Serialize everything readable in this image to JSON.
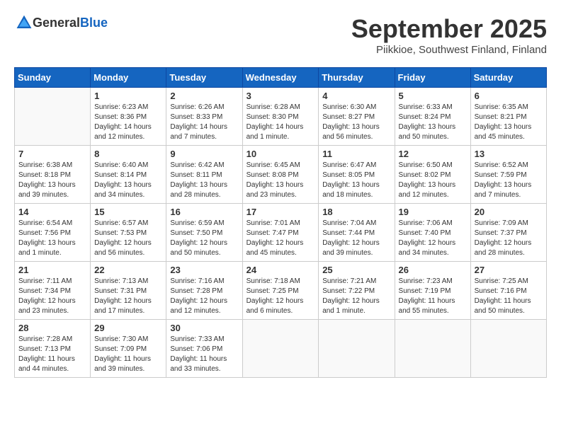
{
  "logo": {
    "general": "General",
    "blue": "Blue"
  },
  "header": {
    "month": "September 2025",
    "location": "Piikkioe, Southwest Finland, Finland"
  },
  "weekdays": [
    "Sunday",
    "Monday",
    "Tuesday",
    "Wednesday",
    "Thursday",
    "Friday",
    "Saturday"
  ],
  "weeks": [
    [
      {
        "day": "",
        "info": ""
      },
      {
        "day": "1",
        "info": "Sunrise: 6:23 AM\nSunset: 8:36 PM\nDaylight: 14 hours\nand 12 minutes."
      },
      {
        "day": "2",
        "info": "Sunrise: 6:26 AM\nSunset: 8:33 PM\nDaylight: 14 hours\nand 7 minutes."
      },
      {
        "day": "3",
        "info": "Sunrise: 6:28 AM\nSunset: 8:30 PM\nDaylight: 14 hours\nand 1 minute."
      },
      {
        "day": "4",
        "info": "Sunrise: 6:30 AM\nSunset: 8:27 PM\nDaylight: 13 hours\nand 56 minutes."
      },
      {
        "day": "5",
        "info": "Sunrise: 6:33 AM\nSunset: 8:24 PM\nDaylight: 13 hours\nand 50 minutes."
      },
      {
        "day": "6",
        "info": "Sunrise: 6:35 AM\nSunset: 8:21 PM\nDaylight: 13 hours\nand 45 minutes."
      }
    ],
    [
      {
        "day": "7",
        "info": "Sunrise: 6:38 AM\nSunset: 8:18 PM\nDaylight: 13 hours\nand 39 minutes."
      },
      {
        "day": "8",
        "info": "Sunrise: 6:40 AM\nSunset: 8:14 PM\nDaylight: 13 hours\nand 34 minutes."
      },
      {
        "day": "9",
        "info": "Sunrise: 6:42 AM\nSunset: 8:11 PM\nDaylight: 13 hours\nand 28 minutes."
      },
      {
        "day": "10",
        "info": "Sunrise: 6:45 AM\nSunset: 8:08 PM\nDaylight: 13 hours\nand 23 minutes."
      },
      {
        "day": "11",
        "info": "Sunrise: 6:47 AM\nSunset: 8:05 PM\nDaylight: 13 hours\nand 18 minutes."
      },
      {
        "day": "12",
        "info": "Sunrise: 6:50 AM\nSunset: 8:02 PM\nDaylight: 13 hours\nand 12 minutes."
      },
      {
        "day": "13",
        "info": "Sunrise: 6:52 AM\nSunset: 7:59 PM\nDaylight: 13 hours\nand 7 minutes."
      }
    ],
    [
      {
        "day": "14",
        "info": "Sunrise: 6:54 AM\nSunset: 7:56 PM\nDaylight: 13 hours\nand 1 minute."
      },
      {
        "day": "15",
        "info": "Sunrise: 6:57 AM\nSunset: 7:53 PM\nDaylight: 12 hours\nand 56 minutes."
      },
      {
        "day": "16",
        "info": "Sunrise: 6:59 AM\nSunset: 7:50 PM\nDaylight: 12 hours\nand 50 minutes."
      },
      {
        "day": "17",
        "info": "Sunrise: 7:01 AM\nSunset: 7:47 PM\nDaylight: 12 hours\nand 45 minutes."
      },
      {
        "day": "18",
        "info": "Sunrise: 7:04 AM\nSunset: 7:44 PM\nDaylight: 12 hours\nand 39 minutes."
      },
      {
        "day": "19",
        "info": "Sunrise: 7:06 AM\nSunset: 7:40 PM\nDaylight: 12 hours\nand 34 minutes."
      },
      {
        "day": "20",
        "info": "Sunrise: 7:09 AM\nSunset: 7:37 PM\nDaylight: 12 hours\nand 28 minutes."
      }
    ],
    [
      {
        "day": "21",
        "info": "Sunrise: 7:11 AM\nSunset: 7:34 PM\nDaylight: 12 hours\nand 23 minutes."
      },
      {
        "day": "22",
        "info": "Sunrise: 7:13 AM\nSunset: 7:31 PM\nDaylight: 12 hours\nand 17 minutes."
      },
      {
        "day": "23",
        "info": "Sunrise: 7:16 AM\nSunset: 7:28 PM\nDaylight: 12 hours\nand 12 minutes."
      },
      {
        "day": "24",
        "info": "Sunrise: 7:18 AM\nSunset: 7:25 PM\nDaylight: 12 hours\nand 6 minutes."
      },
      {
        "day": "25",
        "info": "Sunrise: 7:21 AM\nSunset: 7:22 PM\nDaylight: 12 hours\nand 1 minute."
      },
      {
        "day": "26",
        "info": "Sunrise: 7:23 AM\nSunset: 7:19 PM\nDaylight: 11 hours\nand 55 minutes."
      },
      {
        "day": "27",
        "info": "Sunrise: 7:25 AM\nSunset: 7:16 PM\nDaylight: 11 hours\nand 50 minutes."
      }
    ],
    [
      {
        "day": "28",
        "info": "Sunrise: 7:28 AM\nSunset: 7:13 PM\nDaylight: 11 hours\nand 44 minutes."
      },
      {
        "day": "29",
        "info": "Sunrise: 7:30 AM\nSunset: 7:09 PM\nDaylight: 11 hours\nand 39 minutes."
      },
      {
        "day": "30",
        "info": "Sunrise: 7:33 AM\nSunset: 7:06 PM\nDaylight: 11 hours\nand 33 minutes."
      },
      {
        "day": "",
        "info": ""
      },
      {
        "day": "",
        "info": ""
      },
      {
        "day": "",
        "info": ""
      },
      {
        "day": "",
        "info": ""
      }
    ]
  ]
}
